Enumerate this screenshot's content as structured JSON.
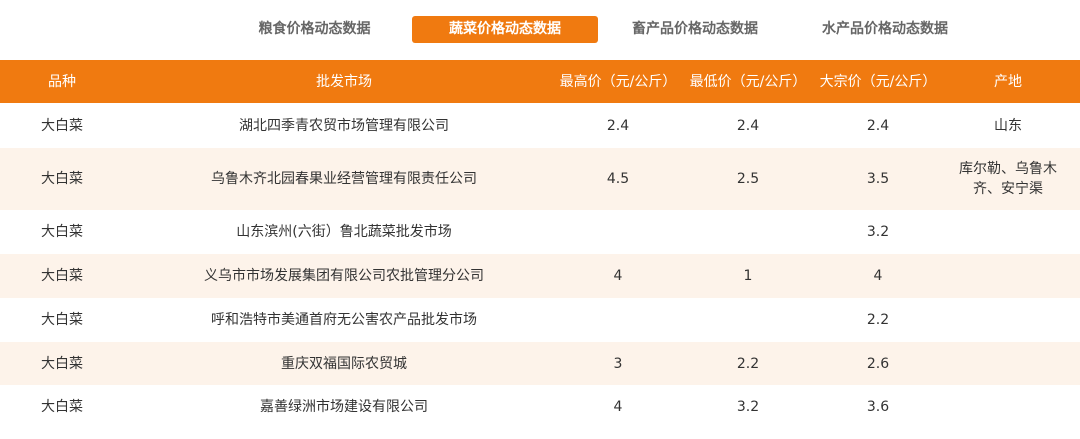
{
  "tabs": [
    {
      "label": "粮食价格动态数据",
      "active": false
    },
    {
      "label": "蔬菜价格动态数据",
      "active": true
    },
    {
      "label": "畜产品价格动态数据",
      "active": false
    },
    {
      "label": "水产品价格动态数据",
      "active": false
    }
  ],
  "table": {
    "headers": [
      "品种",
      "批发市场",
      "最高价（元/公斤）",
      "最低价（元/公斤）",
      "大宗价（元/公斤）",
      "产地"
    ],
    "rows": [
      {
        "variety": "大白菜",
        "market": "湖北四季青农贸市场管理有限公司",
        "max": "2.4",
        "min": "2.4",
        "bulk": "2.4",
        "origin": "山东"
      },
      {
        "variety": "大白菜",
        "market": "乌鲁木齐北园春果业经营管理有限责任公司",
        "max": "4.5",
        "min": "2.5",
        "bulk": "3.5",
        "origin": "库尔勒、乌鲁木齐、安宁渠"
      },
      {
        "variety": "大白菜",
        "market": "山东滨州(六街）鲁北蔬菜批发市场",
        "max": "",
        "min": "",
        "bulk": "3.2",
        "origin": ""
      },
      {
        "variety": "大白菜",
        "market": "义乌市市场发展集团有限公司农批管理分公司",
        "max": "4",
        "min": "1",
        "bulk": "4",
        "origin": ""
      },
      {
        "variety": "大白菜",
        "market": "呼和浩特市美通首府无公害农产品批发市场",
        "max": "",
        "min": "",
        "bulk": "2.2",
        "origin": ""
      },
      {
        "variety": "大白菜",
        "market": "重庆双福国际农贸城",
        "max": "3",
        "min": "2.2",
        "bulk": "2.6",
        "origin": ""
      },
      {
        "variety": "大白菜",
        "market": "嘉善绿洲市场建设有限公司",
        "max": "4",
        "min": "3.2",
        "bulk": "3.6",
        "origin": ""
      }
    ]
  },
  "colors": {
    "accent": "#f07a10",
    "row_alt": "#fdf3ea",
    "text": "#333333",
    "tab_text": "#666666"
  }
}
